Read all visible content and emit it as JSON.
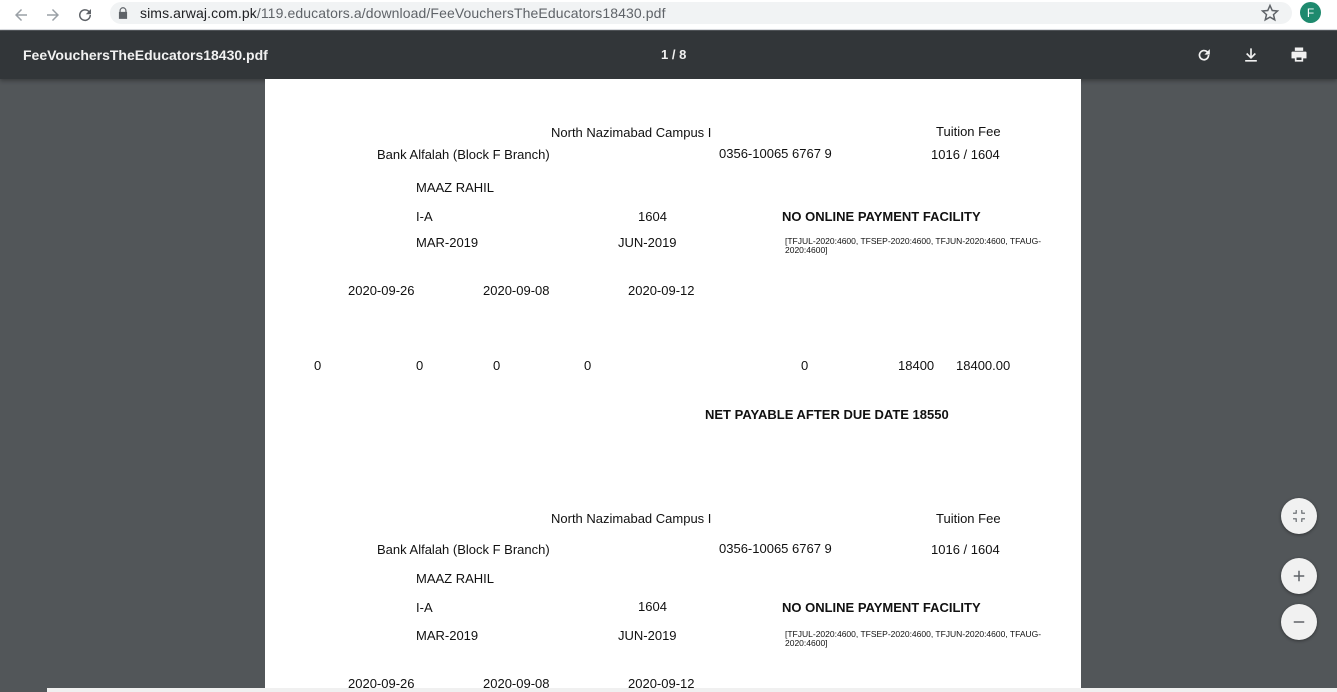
{
  "browser": {
    "url_host": "sims.arwaj.com.pk",
    "url_path": "/119.educators.a/download/FeeVouchersTheEducators18430.pdf",
    "profile_initial": "F"
  },
  "toolbar": {
    "title": "FeeVouchersTheEducators18430.pdf",
    "page_indicator": "1 / 8"
  },
  "voucher1": {
    "campus": "North Nazimabad Campus I",
    "fee_type": "Tuition Fee",
    "bank": "Bank Alfalah (Block F Branch)",
    "account": "0356-10065 6767 9",
    "ref": "1016 / 1604",
    "student_name": "MAAZ RAHIL",
    "class": "I-A",
    "student_id": "1604",
    "online_notice": "NO ONLINE PAYMENT FACILITY",
    "from_month": "MAR-2019",
    "to_month": "JUN-2019",
    "fee_detail": "[TFJUL-2020:4600, TFSEP-2020:4600, TFJUN-2020:4600, TFAUG-2020:4600]",
    "date1": "2020-09-26",
    "date2": "2020-09-08",
    "date3": "2020-09-12",
    "amt1": "0",
    "amt2": "0",
    "amt3": "0",
    "amt4": "0",
    "amt5": "0",
    "amt6": "18400",
    "total": "18400.00",
    "net_payable": "NET PAYABLE AFTER DUE DATE 18550"
  },
  "voucher2": {
    "campus": "North Nazimabad Campus I",
    "fee_type": "Tuition Fee",
    "bank": "Bank Alfalah (Block F Branch)",
    "account": "0356-10065 6767 9",
    "ref": "1016 / 1604",
    "student_name": "MAAZ RAHIL",
    "class": "I-A",
    "student_id": "1604",
    "online_notice": "NO ONLINE PAYMENT FACILITY",
    "from_month": "MAR-2019",
    "to_month": "JUN-2019",
    "fee_detail": "[TFJUL-2020:4600, TFSEP-2020:4600, TFJUN-2020:4600, TFAUG-2020:4600]",
    "date1": "2020-09-26",
    "date2": "2020-09-08",
    "date3": "2020-09-12"
  },
  "icons": {
    "back": "arrow-left-icon",
    "forward": "arrow-right-icon",
    "reload": "reload-icon",
    "lock": "lock-icon",
    "bookmark": "star-icon",
    "rotate": "rotate-icon",
    "download": "download-icon",
    "print": "print-icon",
    "fit": "fit-page-icon",
    "zoom_in": "plus-icon",
    "zoom_out": "minus-icon"
  }
}
